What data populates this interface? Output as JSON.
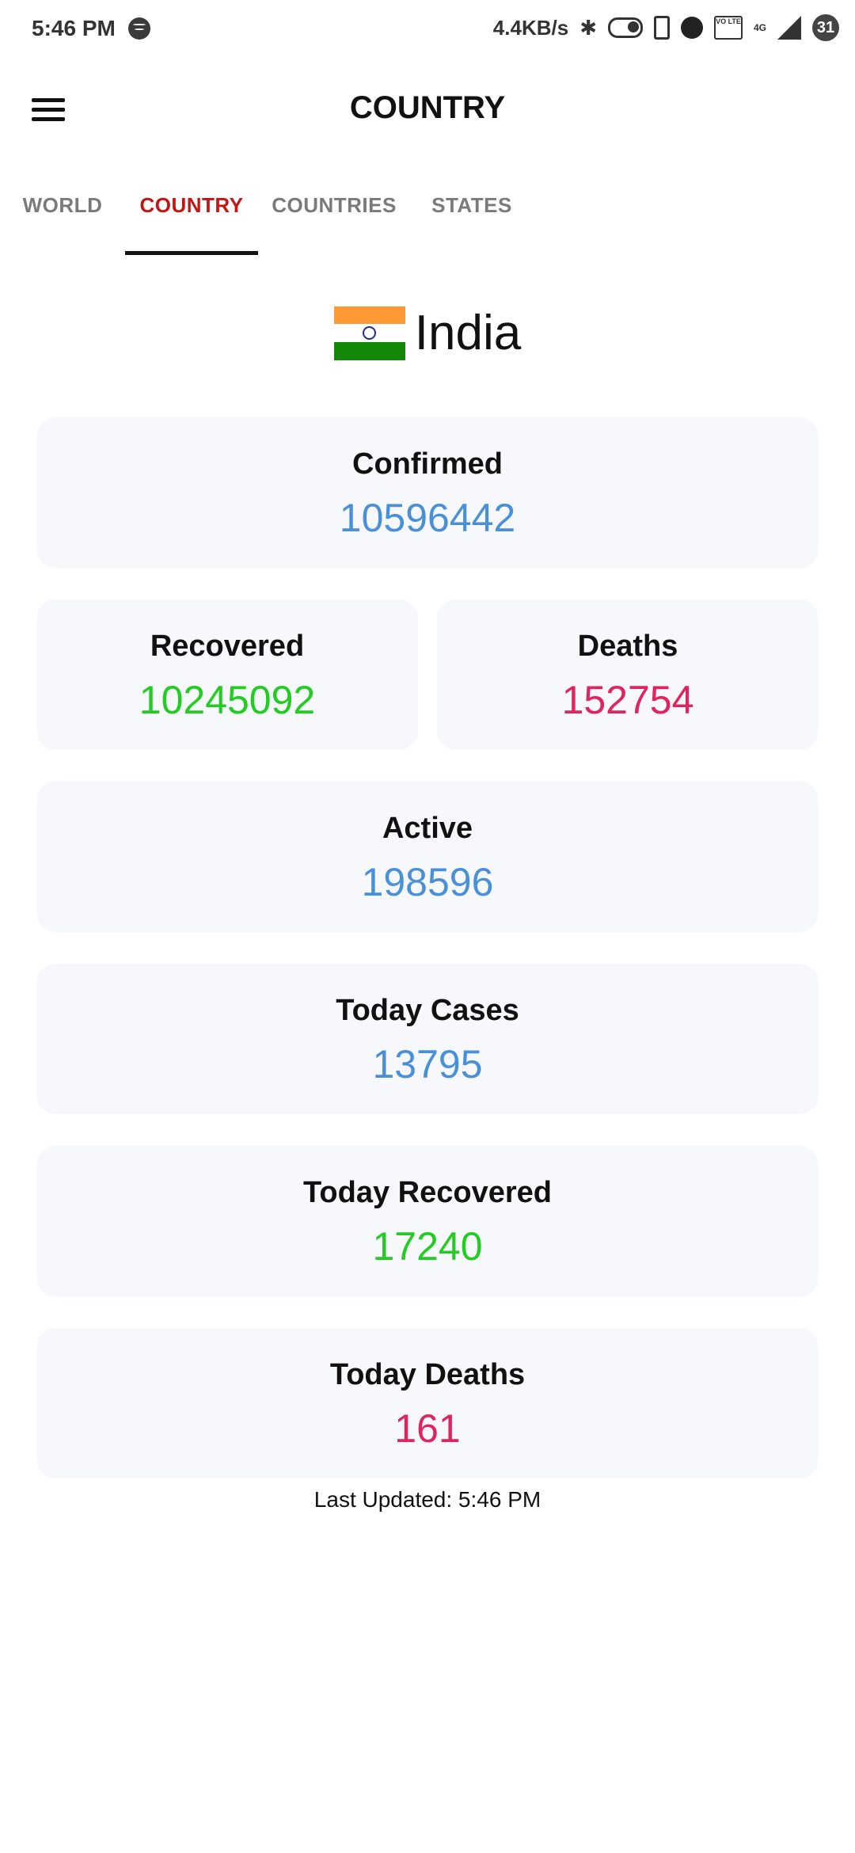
{
  "status_bar": {
    "time": "5:46 PM",
    "network_speed": "4.4KB/s",
    "signal_label": "4G",
    "volte_label": "VO LTE",
    "battery": "31"
  },
  "app_bar": {
    "title": "COUNTRY"
  },
  "tabs": [
    {
      "label": "WORLD",
      "active": false
    },
    {
      "label": "COUNTRY",
      "active": true
    },
    {
      "label": "COUNTRIES",
      "active": false
    },
    {
      "label": "STATES",
      "active": false
    }
  ],
  "country": {
    "name": "India",
    "flag_colors": [
      "#ff9933",
      "#ffffff",
      "#138808"
    ]
  },
  "stats": {
    "confirmed": {
      "label": "Confirmed",
      "value": "10596442",
      "color": "#4a90d9"
    },
    "recovered": {
      "label": "Recovered",
      "value": "10245092",
      "color": "#22cc22"
    },
    "deaths": {
      "label": "Deaths",
      "value": "152754",
      "color": "#e0245e"
    },
    "active": {
      "label": "Active",
      "value": "198596",
      "color": "#4a90d9"
    },
    "today_cases": {
      "label": "Today Cases",
      "value": "13795",
      "color": "#4a90d9"
    },
    "today_recovered": {
      "label": "Today Recovered",
      "value": "17240",
      "color": "#22cc22"
    },
    "today_deaths": {
      "label": "Today Deaths",
      "value": "161",
      "color": "#e0245e"
    }
  },
  "last_updated": "Last Updated: 5:46 PM"
}
